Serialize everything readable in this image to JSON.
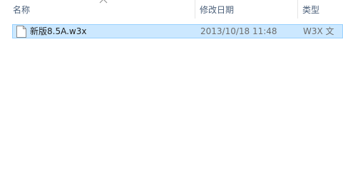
{
  "columns": {
    "name": "名称",
    "date_modified": "修改日期",
    "type": "类型"
  },
  "sort": {
    "column": "name",
    "direction": "ascending",
    "icon": "chevron-up-icon"
  },
  "files": [
    {
      "name": "新版8.5A.w3x",
      "date_modified": "2013/10/18 11:48",
      "type": "W3X 文",
      "icon": "file-icon",
      "selected": true
    }
  ],
  "colors": {
    "selection_fill": "#cce8ff",
    "selection_border": "#99d1ff",
    "header_text": "#4c607a",
    "secondary_text": "#6d6d6d"
  }
}
